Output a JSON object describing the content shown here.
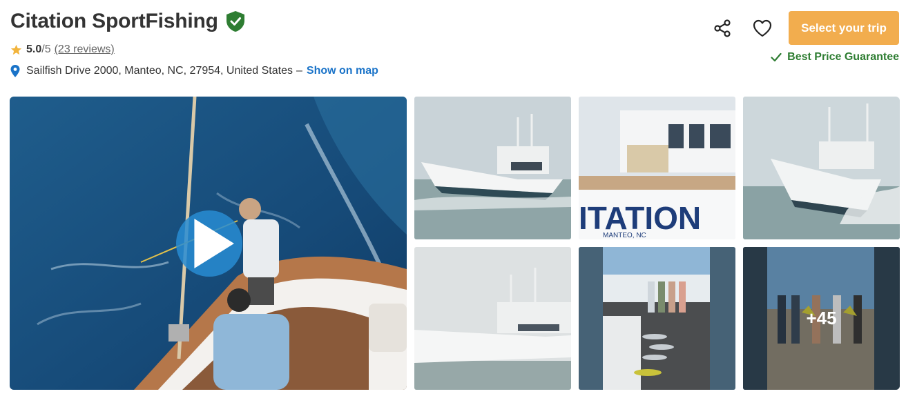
{
  "header": {
    "title": "Citation SportFishing",
    "verified_icon": "verified-shield-icon"
  },
  "rating": {
    "score": "5.0",
    "out_of": "/5",
    "reviews_label": "(23 reviews)",
    "star_color": "#f2b43c"
  },
  "location": {
    "address": "Sailfish Drive 2000, Manteo, NC, 27954, United States",
    "separator": "–",
    "map_link": "Show on map",
    "pin_color": "#1a73c8"
  },
  "actions": {
    "share_icon": "share-icon",
    "favorite_icon": "heart-icon",
    "cta_label": "Select your trip",
    "cta_color": "#f2ad4e",
    "guarantee": "Best Price Guarantee",
    "guarantee_color": "#2e7d32"
  },
  "gallery": {
    "main_media": "video",
    "play_icon": "play-icon",
    "more_count": "+45"
  }
}
